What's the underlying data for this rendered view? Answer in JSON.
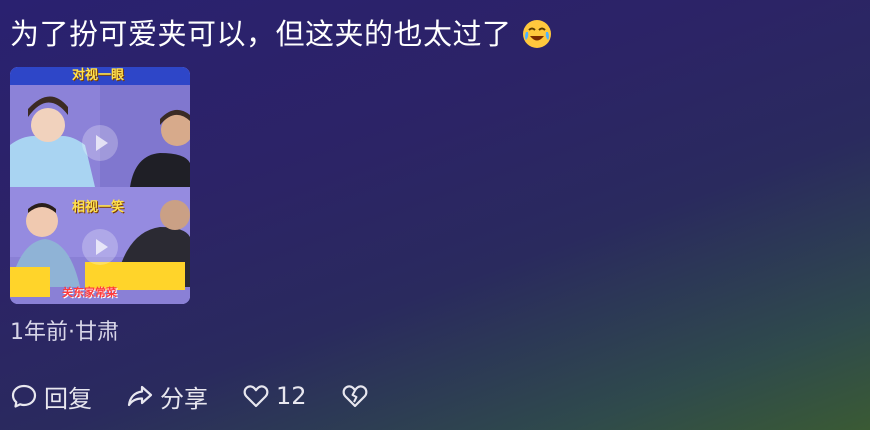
{
  "comment": {
    "text": "为了扮可爱夹可以，但这夹的也太过了",
    "emoji": "crying-laughing-face"
  },
  "video_thumbnail": {
    "top_caption": "对视一眼",
    "bottom_caption": "相视一笑",
    "bottom_banner": "关东家常菜"
  },
  "meta": {
    "time_location": "1年前·甘肃"
  },
  "actions": {
    "reply_label": "回复",
    "share_label": "分享",
    "like_count": "12"
  },
  "colors": {
    "text": "#ffffff",
    "meta_text": "#d8d6e8",
    "bg_top": "#2a2170",
    "bg_bottom": "#3a5a34",
    "caption_bar": "#2e46c8",
    "caption_text": "#ffe14d"
  }
}
